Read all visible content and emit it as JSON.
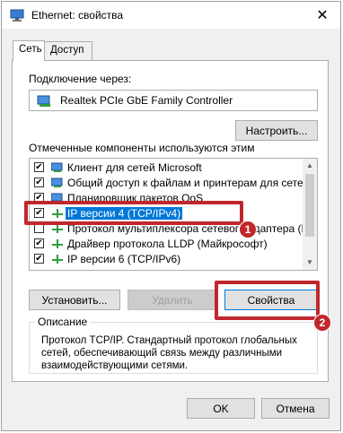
{
  "window": {
    "title": "Ethernet: свойства",
    "close_glyph": "✕"
  },
  "tabs": [
    {
      "label": "Сеть"
    },
    {
      "label": "Доступ"
    }
  ],
  "connect_via_label": "Подключение через:",
  "adapter_name": "Realtek PCIe GbE Family Controller",
  "configure_button": "Настроить...",
  "components_label": "Отмеченные компоненты используются этим подключением:",
  "components": [
    {
      "label": "Клиент для сетей Microsoft",
      "checked": true,
      "icon": "network-client-icon"
    },
    {
      "label": "Общий доступ к файлам и принтерам для сетей Mi",
      "checked": true,
      "icon": "file-sharing-icon"
    },
    {
      "label": "Планировщик пакетов QoS",
      "checked": true,
      "icon": "qos-icon"
    },
    {
      "label": "IP версии 4 (TCP/IPv4)",
      "checked": true,
      "icon": "protocol-icon",
      "selected": true
    },
    {
      "label": "Протокол мультиплексора сетевого адаптера (Май",
      "checked": false,
      "icon": "protocol-icon"
    },
    {
      "label": "Драйвер протокола LLDP (Майкрософт)",
      "checked": true,
      "icon": "protocol-icon"
    },
    {
      "label": "IP версии 6 (TCP/IPv6)",
      "checked": true,
      "icon": "protocol-icon"
    }
  ],
  "buttons": {
    "install": "Установить...",
    "remove": "Удалить",
    "properties": "Свойства"
  },
  "description": {
    "title": "Описание",
    "text": "Протокол TCP/IP. Стандартный протокол глобальных сетей, обеспечивающий связь между различными взаимодействующими сетями."
  },
  "footer": {
    "ok": "OK",
    "cancel": "Отмена"
  },
  "annotations": [
    {
      "number": "1"
    },
    {
      "number": "2"
    }
  ],
  "colors": {
    "accent": "#0078d7",
    "annotation": "#c0272d"
  }
}
